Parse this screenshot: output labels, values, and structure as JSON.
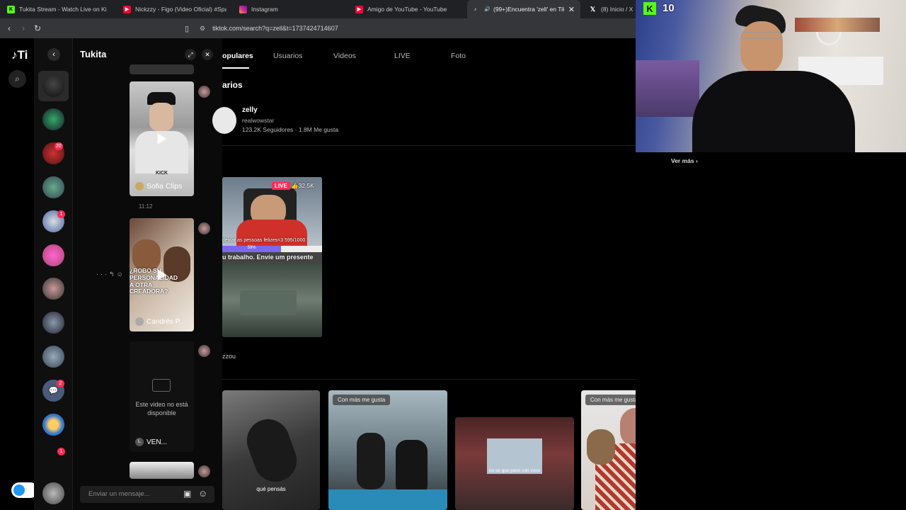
{
  "browser": {
    "tabs": [
      {
        "label": "Tukita Stream - Watch Live on Ki",
        "icon": "kick-icon",
        "color": "#53fc18",
        "active": false
      },
      {
        "label": "Nickzzy - Figo (Video Oficial) #Spanis",
        "icon": "youtube-icon",
        "color": "#ff0033",
        "active": false
      },
      {
        "label": "Instagram",
        "icon": "instagram-icon",
        "color": "#d6249f",
        "active": false
      },
      {
        "label": "Amigo de YouTube - YouTube",
        "icon": "youtube-icon",
        "color": "#ff0033",
        "active": false
      },
      {
        "label": "(99+)Encuentra 'zell' en TikTo",
        "icon": "tiktok-icon",
        "color": "#ffffff",
        "active": true
      },
      {
        "label": "(8) Inicio / X",
        "icon": "x-icon",
        "color": "#ffffff",
        "active": false
      }
    ],
    "url": "tiktok.com/search?q=zell&t=1737424714607"
  },
  "kick_overlay": {
    "viewers": "10"
  },
  "chat": {
    "title": "Tukita",
    "videos": [
      {
        "label": "Sofia Clips",
        "caption_top": "KICK"
      },
      {
        "label": "Candrés P...",
        "caption_top": "¿ROBO SU PERSONALIDAD A OTRA CREADORA?"
      },
      {
        "label": "VEN...",
        "unavailable": "Este video no está disponible",
        "avatar_letter": "L"
      }
    ],
    "timestamp": "11:12",
    "input_placeholder": "Enviar un mensaje...",
    "side_badges": [
      "20",
      "1",
      "2",
      "1"
    ]
  },
  "main": {
    "tabs": [
      "opulares",
      "Usuarios",
      "Videos",
      "LIVE",
      "Foto"
    ],
    "section_title": "arios",
    "user": {
      "name": "zelly",
      "handle": "realwowstar",
      "followers": "123.2K Seguidores",
      "dot": "·",
      "likes": "1.8M Me gusta"
    },
    "live": {
      "badge": "LIVE",
      "likes": "32.5K",
      "overlay1": "deixar as pessoas felizes<3 595/1000",
      "progress": "59%",
      "overlay2": "u trabalho. Envíe um presente"
    },
    "live_caption": "zzou",
    "grid": [
      {
        "chip": "",
        "caption": "qué pensás"
      },
      {
        "chip": "Con más me gusta",
        "caption": ""
      },
      {
        "chip": "",
        "caption": "no se que paso con voce"
      },
      {
        "chip": "Con más me gusta",
        "caption": ""
      }
    ]
  },
  "cam": {
    "ver_mas": "Ver más"
  },
  "colors": {
    "accent": "#fe2c55",
    "kick": "#53fc18"
  }
}
